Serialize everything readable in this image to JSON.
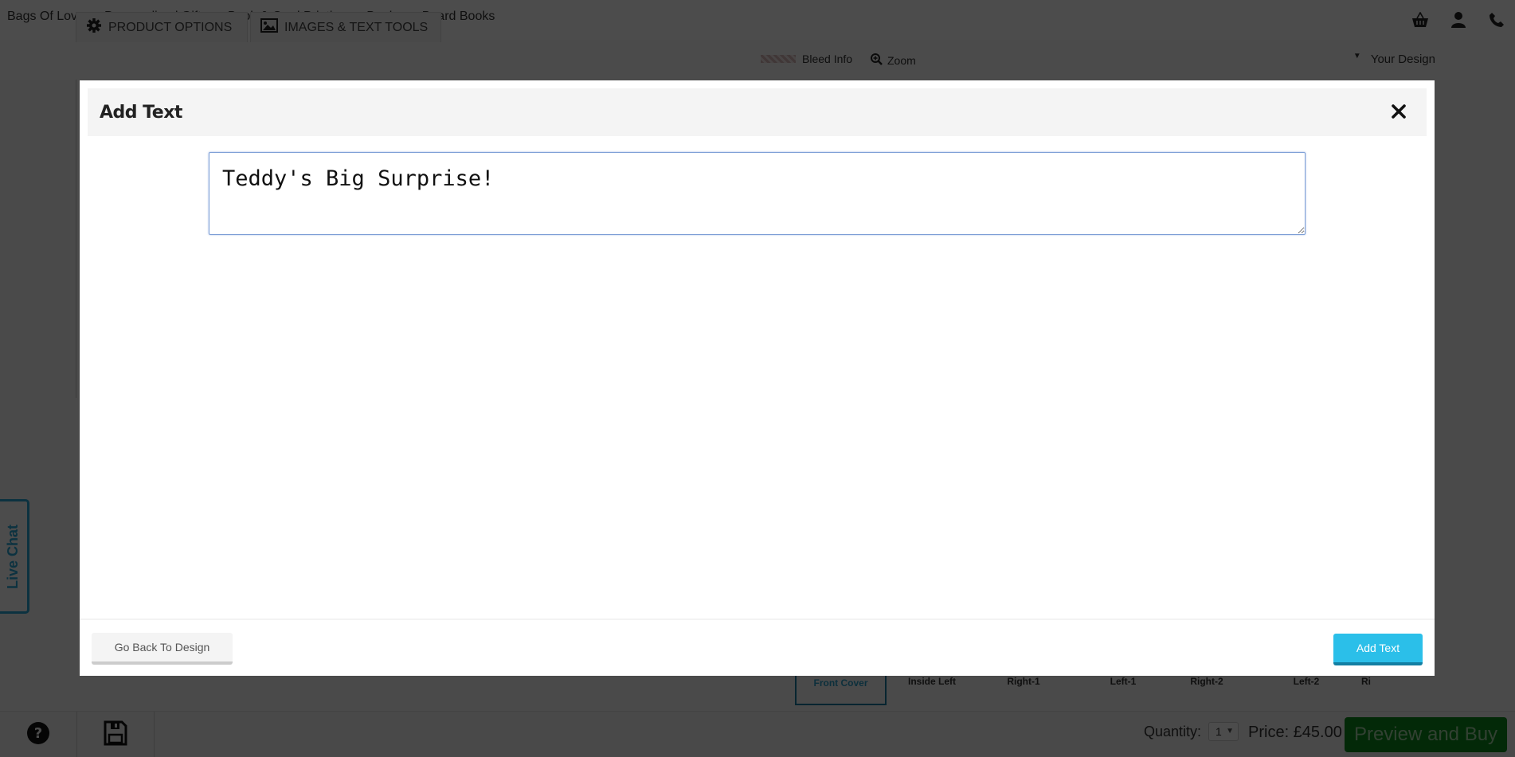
{
  "breadcrumb": [
    "Bags Of Love",
    "Personalised Gifts",
    "Book & Card Printing",
    "Books",
    "Board Books"
  ],
  "breadcrumb_separator": ">",
  "header_icons": [
    "basket-icon",
    "user-icon",
    "phone-icon"
  ],
  "designer": {
    "tabs": [
      {
        "label": "PRODUCT OPTIONS",
        "icon": "gear-icon"
      },
      {
        "label": "IMAGES & TEXT TOOLS",
        "icon": "image-icon"
      }
    ],
    "bleed_info_label": "Bleed Info",
    "zoom_label": "Zoom",
    "your_design_label": "Your Design"
  },
  "pages": [
    {
      "label": "Front Cover",
      "active": true
    },
    {
      "label": "Inside Left",
      "active": false
    },
    {
      "label": "Right-1",
      "active": false
    },
    {
      "label": "Left-1",
      "active": false
    },
    {
      "label": "Right-2",
      "active": false
    },
    {
      "label": "Left-2",
      "active": false
    },
    {
      "label": "Ri",
      "active": false
    }
  ],
  "bottom_bar": {
    "quantity_label": "Quantity:",
    "quantity_value": "1",
    "price_label": "Price: £45.00",
    "preview_buy_label": "Preview and Buy"
  },
  "live_chat_label": "Live Chat",
  "modal": {
    "title": "Add Text",
    "text_value": "Teddy's Big Surprise!",
    "back_button_label": "Go Back To Design",
    "add_button_label": "Add Text"
  },
  "colors": {
    "accent_blue": "#2bbfe9",
    "preview_green": "#0b8a1d",
    "live_chat_blue": "#2ba8d8"
  }
}
